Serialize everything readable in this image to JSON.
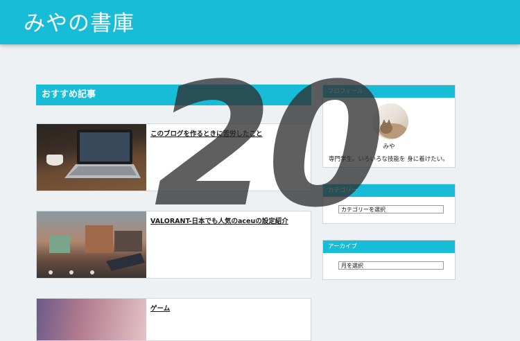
{
  "header": {
    "site_title": "みやの書庫"
  },
  "main": {
    "section_title": "おすすめ記事",
    "articles": [
      {
        "title": "このブログを作るときに苦労したこと",
        "thumb_icon": "laptop-photo"
      },
      {
        "title": "VALORANT-日本でも人気のaceuの設定紹介",
        "thumb_icon": "game-screenshot"
      },
      {
        "title": "ゲーム",
        "thumb_icon": "blurred-photo"
      }
    ]
  },
  "sidebar": {
    "profile": {
      "title": "プロフィール",
      "name": "みや",
      "bio": "専門学生。いろいろな技能を 身に着けたい。",
      "avatar_icon": "cat-avatar"
    },
    "categories": {
      "title": "カテゴリー",
      "select_value": "カテゴリーを選択"
    },
    "archive": {
      "title": "アーカイブ",
      "select_value": "月を選択"
    }
  },
  "overlay": {
    "text": "20"
  },
  "colors": {
    "accent": "#17bcd6",
    "background": "#eef1f4"
  }
}
